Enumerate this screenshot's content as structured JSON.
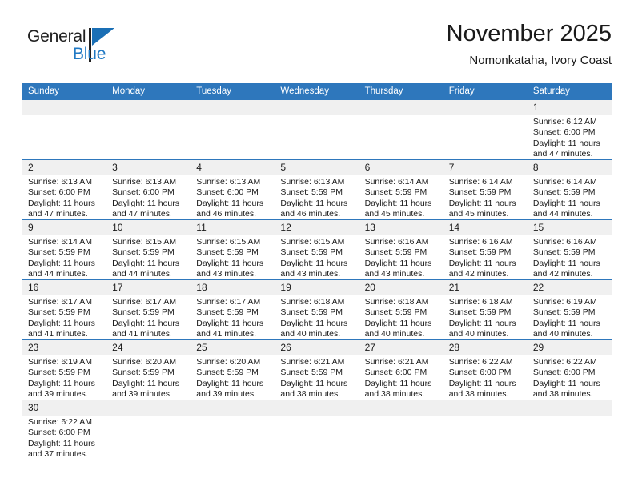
{
  "brand": {
    "word_one": "General",
    "word_two": "Blue",
    "flag_icon": "blue-triangle-flag",
    "accent_color": "#2079C4"
  },
  "header": {
    "title": "November 2025",
    "subtitle": "Nomonkataha, Ivory Coast"
  },
  "theme": {
    "header_blue": "#2E77BC",
    "number_band_gray": "#F0F0F0",
    "text_color": "#1a1a1a"
  },
  "weekdays": [
    "Sunday",
    "Monday",
    "Tuesday",
    "Wednesday",
    "Thursday",
    "Friday",
    "Saturday"
  ],
  "weeks": [
    [
      {
        "day": "",
        "lines": []
      },
      {
        "day": "",
        "lines": []
      },
      {
        "day": "",
        "lines": []
      },
      {
        "day": "",
        "lines": []
      },
      {
        "day": "",
        "lines": []
      },
      {
        "day": "",
        "lines": []
      },
      {
        "day": "1",
        "lines": [
          "Sunrise: 6:12 AM",
          "Sunset: 6:00 PM",
          "Daylight: 11 hours",
          "and 47 minutes."
        ]
      }
    ],
    [
      {
        "day": "2",
        "lines": [
          "Sunrise: 6:13 AM",
          "Sunset: 6:00 PM",
          "Daylight: 11 hours",
          "and 47 minutes."
        ]
      },
      {
        "day": "3",
        "lines": [
          "Sunrise: 6:13 AM",
          "Sunset: 6:00 PM",
          "Daylight: 11 hours",
          "and 47 minutes."
        ]
      },
      {
        "day": "4",
        "lines": [
          "Sunrise: 6:13 AM",
          "Sunset: 6:00 PM",
          "Daylight: 11 hours",
          "and 46 minutes."
        ]
      },
      {
        "day": "5",
        "lines": [
          "Sunrise: 6:13 AM",
          "Sunset: 5:59 PM",
          "Daylight: 11 hours",
          "and 46 minutes."
        ]
      },
      {
        "day": "6",
        "lines": [
          "Sunrise: 6:14 AM",
          "Sunset: 5:59 PM",
          "Daylight: 11 hours",
          "and 45 minutes."
        ]
      },
      {
        "day": "7",
        "lines": [
          "Sunrise: 6:14 AM",
          "Sunset: 5:59 PM",
          "Daylight: 11 hours",
          "and 45 minutes."
        ]
      },
      {
        "day": "8",
        "lines": [
          "Sunrise: 6:14 AM",
          "Sunset: 5:59 PM",
          "Daylight: 11 hours",
          "and 44 minutes."
        ]
      }
    ],
    [
      {
        "day": "9",
        "lines": [
          "Sunrise: 6:14 AM",
          "Sunset: 5:59 PM",
          "Daylight: 11 hours",
          "and 44 minutes."
        ]
      },
      {
        "day": "10",
        "lines": [
          "Sunrise: 6:15 AM",
          "Sunset: 5:59 PM",
          "Daylight: 11 hours",
          "and 44 minutes."
        ]
      },
      {
        "day": "11",
        "lines": [
          "Sunrise: 6:15 AM",
          "Sunset: 5:59 PM",
          "Daylight: 11 hours",
          "and 43 minutes."
        ]
      },
      {
        "day": "12",
        "lines": [
          "Sunrise: 6:15 AM",
          "Sunset: 5:59 PM",
          "Daylight: 11 hours",
          "and 43 minutes."
        ]
      },
      {
        "day": "13",
        "lines": [
          "Sunrise: 6:16 AM",
          "Sunset: 5:59 PM",
          "Daylight: 11 hours",
          "and 43 minutes."
        ]
      },
      {
        "day": "14",
        "lines": [
          "Sunrise: 6:16 AM",
          "Sunset: 5:59 PM",
          "Daylight: 11 hours",
          "and 42 minutes."
        ]
      },
      {
        "day": "15",
        "lines": [
          "Sunrise: 6:16 AM",
          "Sunset: 5:59 PM",
          "Daylight: 11 hours",
          "and 42 minutes."
        ]
      }
    ],
    [
      {
        "day": "16",
        "lines": [
          "Sunrise: 6:17 AM",
          "Sunset: 5:59 PM",
          "Daylight: 11 hours",
          "and 41 minutes."
        ]
      },
      {
        "day": "17",
        "lines": [
          "Sunrise: 6:17 AM",
          "Sunset: 5:59 PM",
          "Daylight: 11 hours",
          "and 41 minutes."
        ]
      },
      {
        "day": "18",
        "lines": [
          "Sunrise: 6:17 AM",
          "Sunset: 5:59 PM",
          "Daylight: 11 hours",
          "and 41 minutes."
        ]
      },
      {
        "day": "19",
        "lines": [
          "Sunrise: 6:18 AM",
          "Sunset: 5:59 PM",
          "Daylight: 11 hours",
          "and 40 minutes."
        ]
      },
      {
        "day": "20",
        "lines": [
          "Sunrise: 6:18 AM",
          "Sunset: 5:59 PM",
          "Daylight: 11 hours",
          "and 40 minutes."
        ]
      },
      {
        "day": "21",
        "lines": [
          "Sunrise: 6:18 AM",
          "Sunset: 5:59 PM",
          "Daylight: 11 hours",
          "and 40 minutes."
        ]
      },
      {
        "day": "22",
        "lines": [
          "Sunrise: 6:19 AM",
          "Sunset: 5:59 PM",
          "Daylight: 11 hours",
          "and 40 minutes."
        ]
      }
    ],
    [
      {
        "day": "23",
        "lines": [
          "Sunrise: 6:19 AM",
          "Sunset: 5:59 PM",
          "Daylight: 11 hours",
          "and 39 minutes."
        ]
      },
      {
        "day": "24",
        "lines": [
          "Sunrise: 6:20 AM",
          "Sunset: 5:59 PM",
          "Daylight: 11 hours",
          "and 39 minutes."
        ]
      },
      {
        "day": "25",
        "lines": [
          "Sunrise: 6:20 AM",
          "Sunset: 5:59 PM",
          "Daylight: 11 hours",
          "and 39 minutes."
        ]
      },
      {
        "day": "26",
        "lines": [
          "Sunrise: 6:21 AM",
          "Sunset: 5:59 PM",
          "Daylight: 11 hours",
          "and 38 minutes."
        ]
      },
      {
        "day": "27",
        "lines": [
          "Sunrise: 6:21 AM",
          "Sunset: 6:00 PM",
          "Daylight: 11 hours",
          "and 38 minutes."
        ]
      },
      {
        "day": "28",
        "lines": [
          "Sunrise: 6:22 AM",
          "Sunset: 6:00 PM",
          "Daylight: 11 hours",
          "and 38 minutes."
        ]
      },
      {
        "day": "29",
        "lines": [
          "Sunrise: 6:22 AM",
          "Sunset: 6:00 PM",
          "Daylight: 11 hours",
          "and 38 minutes."
        ]
      }
    ],
    [
      {
        "day": "30",
        "lines": [
          "Sunrise: 6:22 AM",
          "Sunset: 6:00 PM",
          "Daylight: 11 hours",
          "and 37 minutes."
        ]
      },
      {
        "day": "",
        "lines": []
      },
      {
        "day": "",
        "lines": []
      },
      {
        "day": "",
        "lines": []
      },
      {
        "day": "",
        "lines": []
      },
      {
        "day": "",
        "lines": []
      },
      {
        "day": "",
        "lines": []
      }
    ]
  ]
}
